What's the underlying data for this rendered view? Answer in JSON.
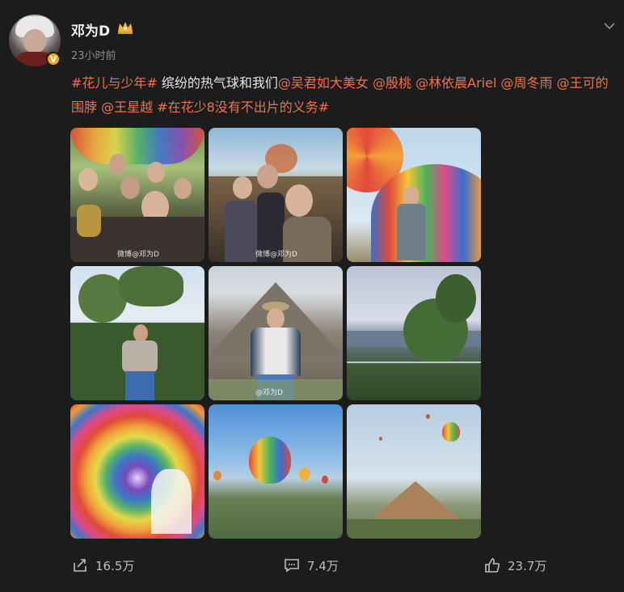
{
  "user": {
    "name": "邓为D",
    "verified_badge": "V",
    "time": "23小时前"
  },
  "post": {
    "segments": [
      {
        "text": "#花儿与少年#",
        "link": true
      },
      {
        "text": " 缤纷的热气球和我们",
        "link": false
      },
      {
        "text": "@吴君如大美女",
        "link": true
      },
      {
        "text": " ",
        "link": false
      },
      {
        "text": "@殷桃",
        "link": true
      },
      {
        "text": " ",
        "link": false
      },
      {
        "text": "@林依晨Ariel",
        "link": true
      },
      {
        "text": " ",
        "link": false
      },
      {
        "text": "@周冬雨",
        "link": true
      },
      {
        "text": " ",
        "link": false
      },
      {
        "text": "@王可的围脖",
        "link": true
      },
      {
        "text": " ",
        "link": false
      },
      {
        "text": "@王星越",
        "link": true
      },
      {
        "text": " ",
        "link": false
      },
      {
        "text": "#在花少8没有不出片的义务#",
        "link": true
      }
    ]
  },
  "photos": {
    "watermark_1": "微博@邓为D",
    "watermark_2": "微博@邓为D",
    "watermark_5": "@邓为D"
  },
  "actions": {
    "share_count": "16.5万",
    "comment_count": "7.4万",
    "like_count": "23.7万"
  },
  "colors": {
    "background": "#1c1c1d",
    "link": "#eb7350",
    "muted": "#8d8d8d"
  },
  "icons": {
    "more": "chevron-down-icon",
    "crown": "crown-icon",
    "share": "share-icon",
    "comment": "comment-icon",
    "like": "thumbs-up-icon"
  }
}
